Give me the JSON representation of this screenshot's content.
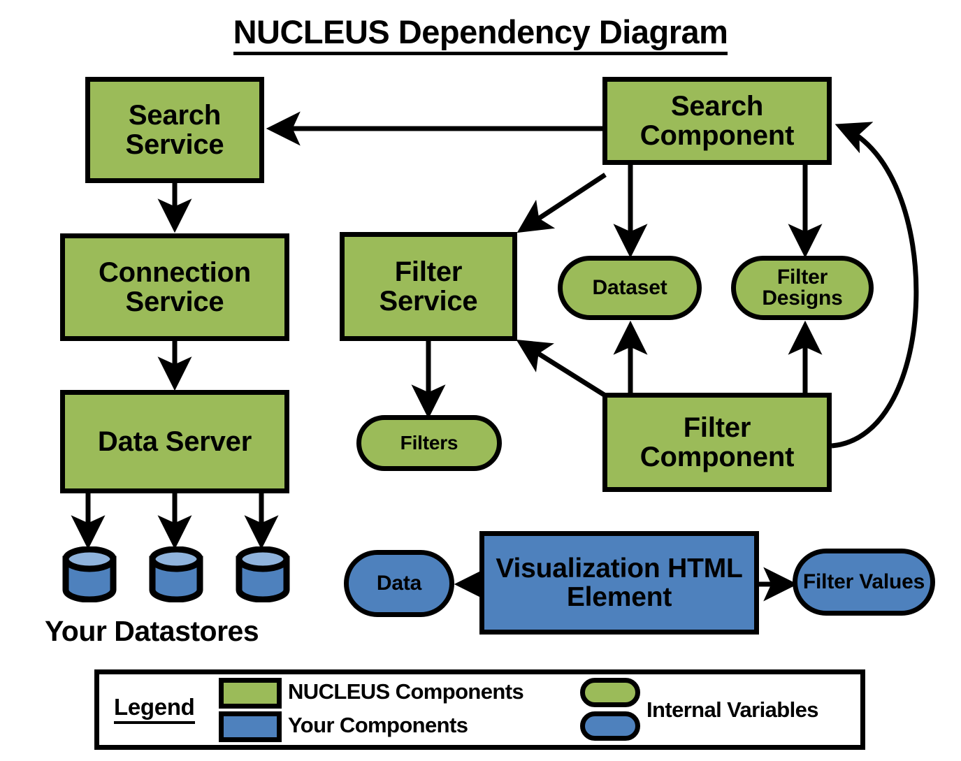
{
  "title": "NUCLEUS Dependency Diagram",
  "colors": {
    "nucleus_green": "#9BBB59",
    "your_blue": "#4E81BD",
    "datastore_top": "#8FB3DC",
    "outline": "#000000",
    "background": "#FFFFFF"
  },
  "nodes": {
    "search_service": "Search Service",
    "connection_service": "Connection Service",
    "data_server": "Data Server",
    "filter_service": "Filter Service",
    "filters": "Filters",
    "search_component": "Search Component",
    "filter_component": "Filter Component",
    "dataset": "Dataset",
    "filter_designs": "Filter Designs",
    "visualization_html_element": "Visualization HTML Element",
    "data": "Data",
    "filter_values": "Filter Values"
  },
  "datastores": {
    "label": "Your Datastores",
    "count": 3
  },
  "legend": {
    "title": "Legend",
    "entries": [
      {
        "label": "NUCLEUS Components",
        "shape": "rect",
        "color": "#9BBB59"
      },
      {
        "label": "Your Components",
        "shape": "rect",
        "color": "#4E81BD"
      },
      {
        "label": "Internal Variables",
        "shape": "pill",
        "color": "#9BBB59"
      }
    ],
    "internal_variables_label": "Internal Variables"
  },
  "edges": [
    {
      "from": "search_component",
      "to": "search_service",
      "style": "straight-left"
    },
    {
      "from": "search_service",
      "to": "connection_service",
      "style": "straight-down"
    },
    {
      "from": "connection_service",
      "to": "data_server",
      "style": "straight-down"
    },
    {
      "from": "data_server",
      "to": "datastore_1",
      "style": "straight-down"
    },
    {
      "from": "data_server",
      "to": "datastore_2",
      "style": "straight-down"
    },
    {
      "from": "data_server",
      "to": "datastore_3",
      "style": "straight-down"
    },
    {
      "from": "search_component",
      "to": "filter_service",
      "style": "diagonal"
    },
    {
      "from": "search_component",
      "to": "dataset",
      "style": "straight-down"
    },
    {
      "from": "search_component",
      "to": "filter_designs",
      "style": "straight-down"
    },
    {
      "from": "filter_service",
      "to": "filters",
      "style": "straight-down"
    },
    {
      "from": "filter_component",
      "to": "dataset",
      "style": "straight-up"
    },
    {
      "from": "filter_component",
      "to": "filter_designs",
      "style": "straight-up"
    },
    {
      "from": "filter_component",
      "to": "filter_service",
      "style": "diagonal"
    },
    {
      "from": "filter_component",
      "to": "search_component",
      "style": "curved-right"
    },
    {
      "from": "visualization_html_element",
      "to": "data",
      "style": "straight-left"
    },
    {
      "from": "visualization_html_element",
      "to": "filter_values",
      "style": "straight-right"
    }
  ]
}
